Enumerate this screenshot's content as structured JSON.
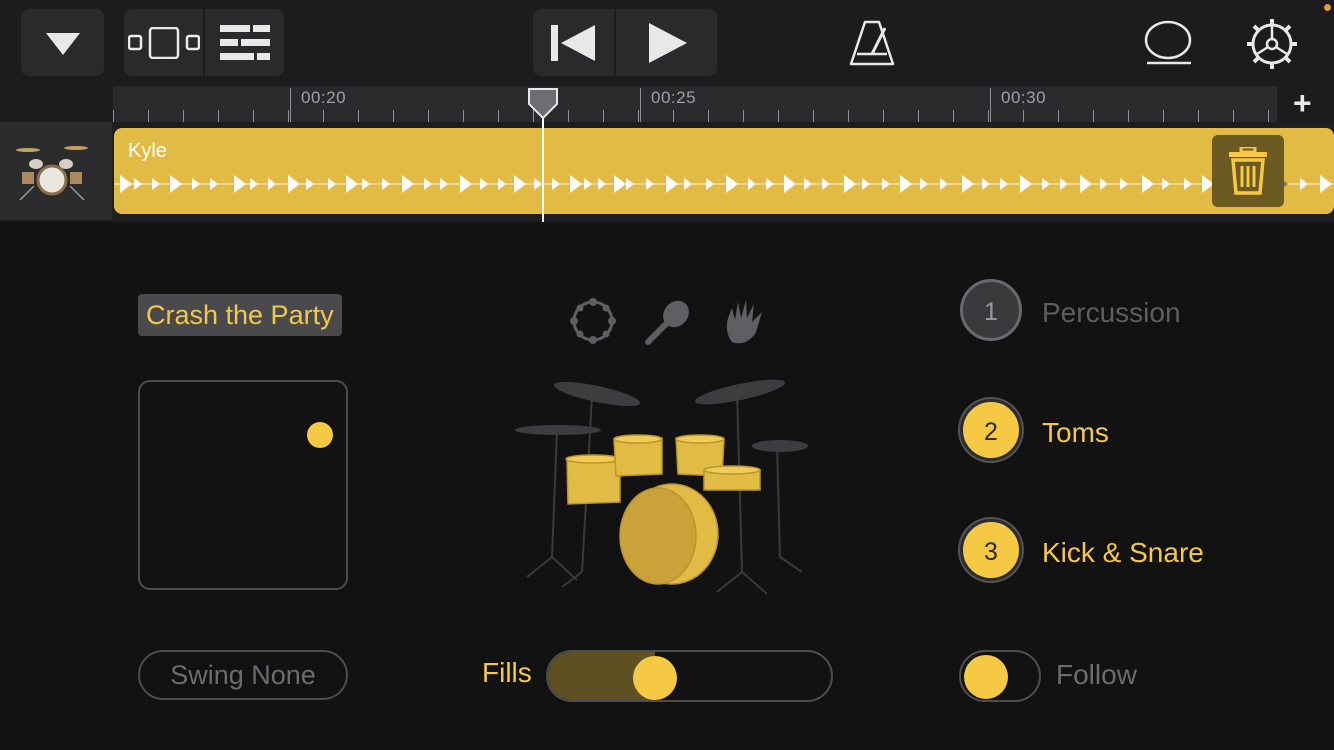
{
  "toolbar": {
    "tracks_menu_icon": "triangle-down-icon",
    "view_icon": "tracks-view-icon",
    "mixer_icon": "mixer-icon",
    "rewind_icon": "rewind-icon",
    "play_icon": "play-icon",
    "metronome_icon": "metronome-icon",
    "loop_icon": "loop-browser-icon",
    "settings_icon": "gear-icon"
  },
  "ruler": {
    "labels": [
      "00:20",
      "00:25",
      "00:30"
    ],
    "add_icon": "+"
  },
  "track": {
    "region_name": "Kyle",
    "delete_icon": "trash-icon"
  },
  "drummer": {
    "preset_name": "Crash the Party",
    "percussion_icons": [
      "tambourine-icon",
      "shaker-icon",
      "hand-clap-icon"
    ],
    "parts": [
      {
        "number": "1",
        "label": "Percussion",
        "active": false
      },
      {
        "number": "2",
        "label": "Toms",
        "active": true
      },
      {
        "number": "3",
        "label": "Kick & Snare",
        "active": true
      }
    ],
    "swing_label": "Swing None",
    "fills_label": "Fills",
    "fills_level": 0.35,
    "follow_label": "Follow",
    "follow_on": false
  },
  "colors": {
    "accent": "#f6c944",
    "region": "#e2bb44",
    "background": "#121212"
  }
}
